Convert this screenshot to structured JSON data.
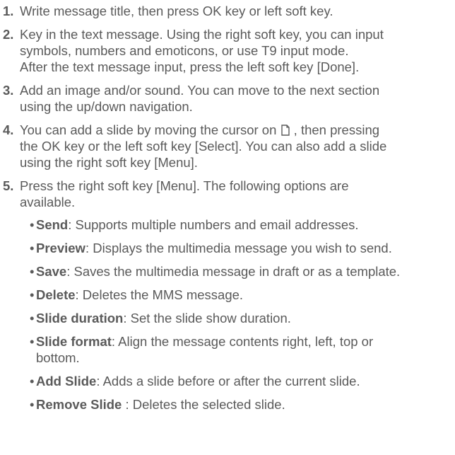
{
  "steps": [
    {
      "number": "1.",
      "lines": [
        "Write message title, then press OK key or left soft key."
      ]
    },
    {
      "number": "2.",
      "lines": [
        "Key in the text message. Using the right soft key, you can input",
        "symbols, numbers and emoticons, or use T9 input mode.",
        "After the text message input, press the left soft key [Done]."
      ]
    },
    {
      "number": "3.",
      "lines": [
        "Add an image and/or sound. You can move to the next section",
        "using the up/down navigation."
      ]
    },
    {
      "number": "4.",
      "line1_before_icon": "You can add a slide by moving the cursor on ",
      "line1_after_icon": " , then pressing",
      "lines": [
        "the OK key or the left soft key [Select]. You can also add a slide",
        "using the right soft key [Menu]."
      ]
    },
    {
      "number": "5.",
      "lines": [
        "Press the right soft key [Menu]. The following options are",
        "available."
      ]
    }
  ],
  "options": [
    {
      "bullet": "•",
      "title": "Send",
      "desc": ": Supports multiple numbers and email addresses."
    },
    {
      "bullet": "•",
      "title": "Preview",
      "desc": ": Displays the multimedia message you wish to send."
    },
    {
      "bullet": "•",
      "title": "Save",
      "desc": ": Saves the multimedia message in draft or as a template."
    },
    {
      "bullet": "•",
      "title": "Delete",
      "desc": ": Deletes the MMS message."
    },
    {
      "bullet": "•",
      "title": "Slide duration",
      "desc": ": Set the slide show duration."
    },
    {
      "bullet": "•",
      "title": "Slide format",
      "desc": ": Align the message contents right, left, top or",
      "desc2": "bottom."
    },
    {
      "bullet": "•",
      "title": "Add Slide",
      "desc": ": Adds a slide before or after the current slide."
    },
    {
      "bullet": "•",
      "title": "Remove Slide",
      "desc": " : Deletes the selected slide."
    }
  ],
  "icons": {
    "new_slide": "new-page-icon"
  }
}
